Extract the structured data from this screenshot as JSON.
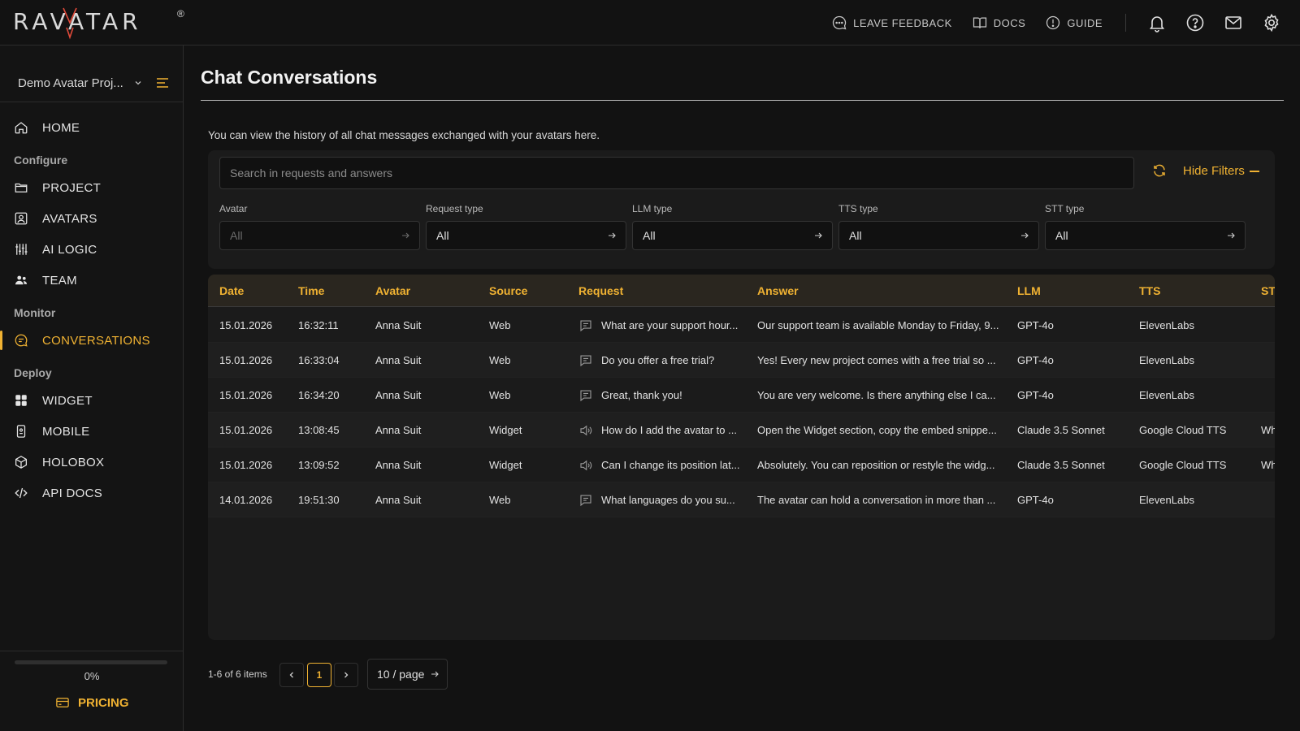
{
  "app": {
    "logo_text": "RAVATAR",
    "logo_reg": "®"
  },
  "topbar": {
    "links": [
      {
        "label": "LEAVE FEEDBACK",
        "icon": "feedback-icon"
      },
      {
        "label": "DOCS",
        "icon": "book-icon"
      },
      {
        "label": "GUIDE",
        "icon": "guide-icon"
      }
    ],
    "icons": [
      "bell-icon",
      "help-icon",
      "mail-icon",
      "settings-icon"
    ]
  },
  "sidebar": {
    "project_name": "Demo Avatar Proj...",
    "home": "HOME",
    "sections": {
      "configure": "Configure",
      "monitor": "Monitor",
      "deploy": "Deploy"
    },
    "items": {
      "project": "PROJECT",
      "avatars": "AVATARS",
      "ai_logic": "AI LOGIC",
      "team": "TEAM",
      "conversations": "CONVERSATIONS",
      "widget": "WIDGET",
      "mobile": "MOBILE",
      "holobox": "HOLOBOX",
      "api_docs": "API DOCS"
    },
    "usage_percent": "0%",
    "usage_fraction": 0,
    "pricing": "PRICING"
  },
  "main": {
    "title": "Chat Conversations",
    "description": "You can view the history of all chat messages exchanged with your avatars here.",
    "search_placeholder": "Search in requests and answers",
    "hide_filters": "Hide Filters",
    "filters": [
      {
        "label": "Avatar",
        "value": "All",
        "disabled": true
      },
      {
        "label": "Request type",
        "value": "All",
        "disabled": false
      },
      {
        "label": "LLM type",
        "value": "All",
        "disabled": false
      },
      {
        "label": "TTS type",
        "value": "All",
        "disabled": false
      },
      {
        "label": "STT type",
        "value": "All",
        "disabled": false
      }
    ],
    "columns": [
      "Date",
      "Time",
      "Avatar",
      "Source",
      "Request",
      "Answer",
      "LLM",
      "TTS",
      "ST"
    ],
    "rows": [
      {
        "date": "15.01.2026",
        "time": "16:32:11",
        "avatar": "Anna Suit",
        "source": "Web",
        "type_icon": "chat-icon",
        "request": "What are your support hour...",
        "answer": "Our support team is available Monday to Friday, 9...",
        "llm": "GPT-4o",
        "tts": "ElevenLabs",
        "stt": ""
      },
      {
        "date": "15.01.2026",
        "time": "16:33:04",
        "avatar": "Anna Suit",
        "source": "Web",
        "type_icon": "chat-icon",
        "request": "Do you offer a free trial?",
        "answer": "Yes! Every new project comes with a free trial so ...",
        "llm": "GPT-4o",
        "tts": "ElevenLabs",
        "stt": ""
      },
      {
        "date": "15.01.2026",
        "time": "16:34:20",
        "avatar": "Anna Suit",
        "source": "Web",
        "type_icon": "chat-icon",
        "request": "Great, thank you!",
        "answer": "You are very welcome. Is there anything else I ca...",
        "llm": "GPT-4o",
        "tts": "ElevenLabs",
        "stt": ""
      },
      {
        "date": "15.01.2026",
        "time": "13:08:45",
        "avatar": "Anna Suit",
        "source": "Widget",
        "type_icon": "speaker-icon",
        "request": "How do I add the avatar to ...",
        "answer": "Open the Widget section, copy the embed snippe...",
        "llm": "Claude 3.5 Sonnet",
        "tts": "Google Cloud TTS",
        "stt": "Wh"
      },
      {
        "date": "15.01.2026",
        "time": "13:09:52",
        "avatar": "Anna Suit",
        "source": "Widget",
        "type_icon": "speaker-icon",
        "request": "Can I change its position lat...",
        "answer": "Absolutely. You can reposition or restyle the widg...",
        "llm": "Claude 3.5 Sonnet",
        "tts": "Google Cloud TTS",
        "stt": "Wh"
      },
      {
        "date": "14.01.2026",
        "time": "19:51:30",
        "avatar": "Anna Suit",
        "source": "Web",
        "type_icon": "chat-icon",
        "request": "What languages do you su...",
        "answer": "The avatar can hold a conversation in more than ...",
        "llm": "GPT-4o",
        "tts": "ElevenLabs",
        "stt": ""
      }
    ],
    "pagination": {
      "total_text": "1-6 of 6 items",
      "current_page": "1",
      "page_size": "10 / page"
    }
  },
  "colors": {
    "accent": "#f0b232",
    "background": "#121212",
    "panel": "#1b1b1b"
  }
}
